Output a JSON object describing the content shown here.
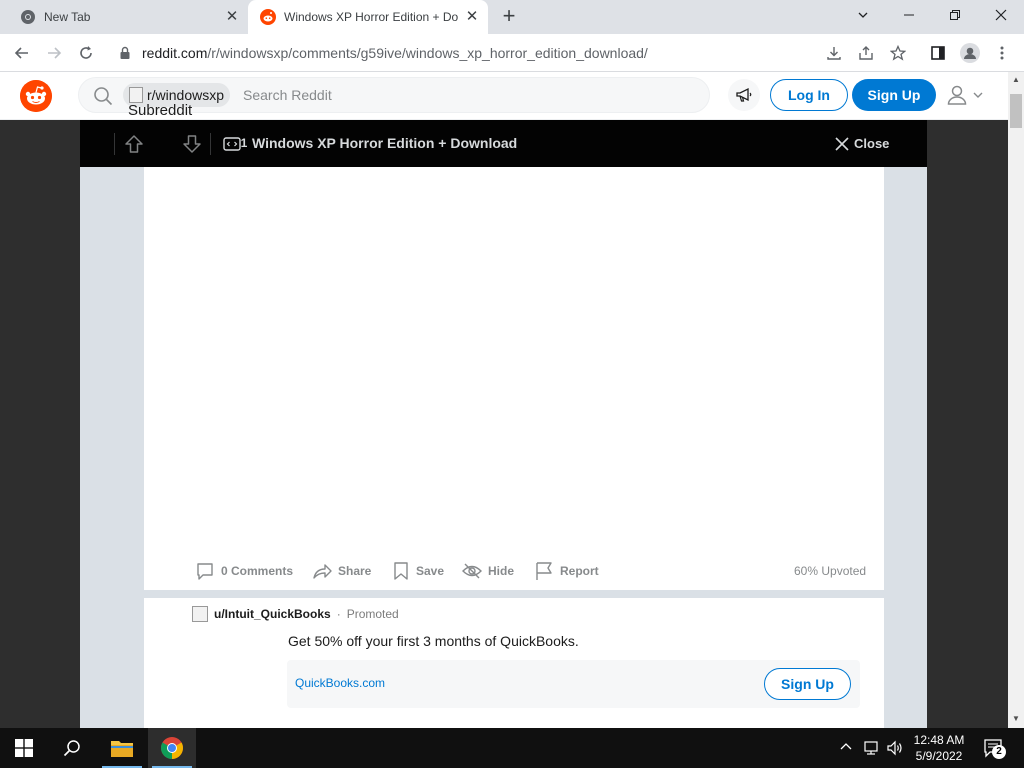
{
  "browser": {
    "tabs": [
      {
        "title": "New Tab",
        "active": false
      },
      {
        "title": "Windows XP Horror Edition + Do",
        "active": true
      }
    ],
    "url": {
      "host": "reddit.com",
      "path": "/r/windowsxp/comments/g59ive/windows_xp_horror_edition_download/"
    }
  },
  "reddit_header": {
    "subreddit_pill": "r/windowsxp",
    "subreddit_alt": "Subreddit",
    "search_placeholder": "Search Reddit",
    "login_label": "Log In",
    "signup_label": "Sign Up"
  },
  "post_bar": {
    "vote_count": "1",
    "title": "Windows XP Horror Edition + Download",
    "close_label": "Close"
  },
  "post_actions": {
    "comments": "0 Comments",
    "share": "Share",
    "save": "Save",
    "hide": "Hide",
    "report": "Report",
    "upvoted": "60% Upvoted"
  },
  "ad": {
    "user": "u/Intuit_QuickBooks",
    "separator": "·",
    "promoted": "Promoted",
    "text": "Get 50% off your first 3 months of QuickBooks.",
    "domain": "QuickBooks.com",
    "cta": "Sign Up"
  },
  "taskbar": {
    "time": "12:48 AM",
    "date": "5/9/2022",
    "notification_count": "2"
  },
  "colors": {
    "reddit_orange": "#ff4500",
    "reddit_blue": "#0079d3",
    "post_bar": "#030303"
  }
}
